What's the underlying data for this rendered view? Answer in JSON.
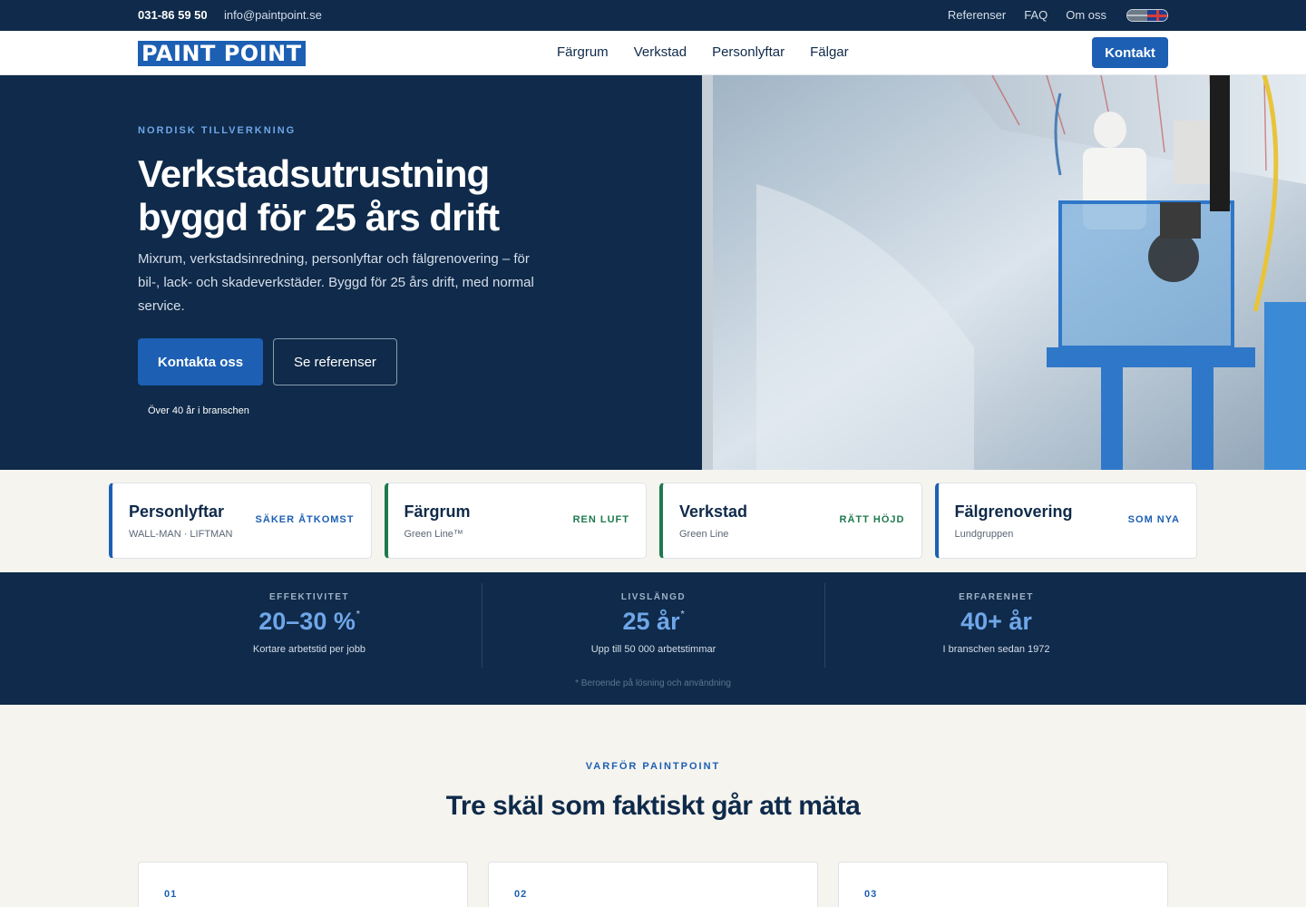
{
  "topbar": {
    "phone": "031-86 59 50",
    "email": "info@paintpoint.se",
    "links": [
      "Referenser",
      "FAQ",
      "Om oss"
    ],
    "lang_icon": "flag-sweden-uk-icon"
  },
  "header": {
    "logo": "PAINT POINT",
    "nav": [
      "Färgrum",
      "Verkstad",
      "Personlyftar",
      "Fälgar"
    ],
    "cta": "Kontakt"
  },
  "hero": {
    "eyebrow": "NORDISK TILLVERKNING",
    "title": "Verkstadsutrustning byggd för 25 års drift",
    "subtitle": "Mixrum, verkstadsinredning, personlyftar och fälgrenovering – för bil-, lack- och skadeverkstäder. Byggd för 25 års drift, med normal service.",
    "primary_button": "Kontakta oss",
    "secondary_button": "Se referenser",
    "note": "Över 40 år i branschen"
  },
  "cards": [
    {
      "title": "Personlyftar",
      "subtitle": "WALL-MAN · LIFTMAN",
      "badge": "SÄKER ÅTKOMST"
    },
    {
      "title": "Färgrum",
      "subtitle": "Green Line™",
      "badge": "REN LUFT"
    },
    {
      "title": "Verkstad",
      "subtitle": "Green Line",
      "badge": "RÄTT HÖJD"
    },
    {
      "title": "Fälgrenovering",
      "subtitle": "Lundgruppen",
      "badge": "SOM NYA"
    }
  ],
  "colors": {
    "navy": "#0f2a4a",
    "accent_blue": "#1c5fb3",
    "accent_green": "#1e7a4e",
    "stat_blue": "#6fa6e8"
  },
  "stats": {
    "items": [
      {
        "label": "EFFEKTIVITET",
        "value": "20–30 %",
        "mark": "*",
        "desc": "Kortare arbetstid per jobb"
      },
      {
        "label": "LIVSLÄNGD",
        "value": "25 år",
        "mark": "*",
        "desc": "Upp till 50 000 arbetstimmar"
      },
      {
        "label": "ERFARENHET",
        "value": "40+ år",
        "mark": "",
        "desc": "I branschen sedan 1972"
      }
    ],
    "footnote": "* Beroende på lösning och användning"
  },
  "why": {
    "eyebrow": "VARFÖR PAINTPOINT",
    "title": "Tre skäl som faktiskt går att mäta",
    "reasons": [
      {
        "num": "01"
      },
      {
        "num": "02"
      },
      {
        "num": "03"
      }
    ]
  }
}
